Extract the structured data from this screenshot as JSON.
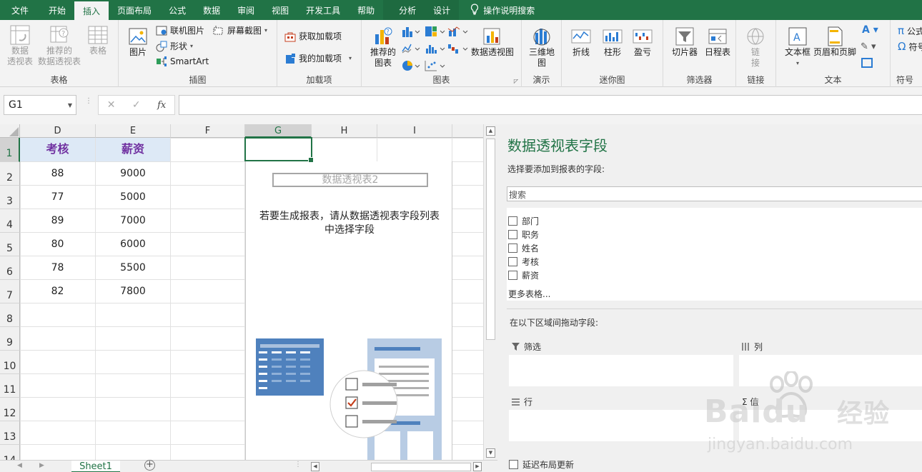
{
  "tabs": [
    "文件",
    "开始",
    "插入",
    "页面布局",
    "公式",
    "数据",
    "审阅",
    "视图",
    "开发工具",
    "帮助",
    "分析",
    "设计"
  ],
  "tab_search": "操作说明搜索",
  "ribbon": {
    "table_group": {
      "label": "表格",
      "pivot": "数据\n透视表",
      "rec_pivot": "推荐的\n数据透视表",
      "table": "表格"
    },
    "illus_group": {
      "label": "插图",
      "picture": "图片",
      "online_pic": "联机图片",
      "shapes": "形状",
      "smartart": "SmartArt",
      "screenshot": "屏幕截图"
    },
    "addin_group": {
      "label": "加载项",
      "get": "获取加载项",
      "my": "我的加载项"
    },
    "chart_group": {
      "label": "图表",
      "rec": "推荐的\n图表",
      "pivotchart": "数据透视图"
    },
    "tour_group": {
      "label": "演示",
      "map3d": "三维地\n图"
    },
    "spark_group": {
      "label": "迷你图",
      "line": "折线",
      "column": "柱形",
      "winloss": "盈亏"
    },
    "filter_group": {
      "label": "筛选器",
      "slicer": "切片器",
      "timeline": "日程表"
    },
    "link_group": {
      "label": "链接",
      "link": "链\n接"
    },
    "text_group": {
      "label": "文本",
      "textbox": "文本框",
      "header": "页眉和页脚"
    },
    "sym_group": {
      "label": "符号",
      "eq": "公式",
      "sym": "符号"
    }
  },
  "namebox": "G1",
  "fx": "fx",
  "columns": [
    "D",
    "E",
    "F",
    "G",
    "H",
    "I"
  ],
  "rows": [
    "1",
    "2",
    "3",
    "4",
    "5",
    "6",
    "7",
    "8",
    "9",
    "10",
    "11",
    "12",
    "13",
    "14"
  ],
  "table": {
    "headers": [
      "考核",
      "薪资"
    ],
    "rows": [
      [
        "88",
        "9000"
      ],
      [
        "77",
        "5000"
      ],
      [
        "89",
        "7000"
      ],
      [
        "80",
        "6000"
      ],
      [
        "78",
        "5500"
      ],
      [
        "82",
        "7800"
      ]
    ]
  },
  "pivot": {
    "title": "数据透视表2",
    "msg_line1": "若要生成报表，请从数据透视表字段列表",
    "msg_line2": "中选择字段"
  },
  "sheet": "Sheet1",
  "panel": {
    "title": "数据透视表字段",
    "subtitle": "选择要添加到报表的字段:",
    "search_placeholder": "搜索",
    "fields": [
      "部门",
      "职务",
      "姓名",
      "考核",
      "薪资"
    ],
    "more": "更多表格...",
    "drag_label": "在以下区域间拖动字段:",
    "areas": {
      "filter": "筛选",
      "columns": "列",
      "rows": "行",
      "values": "Σ 值"
    },
    "defer": "延迟布局更新"
  },
  "watermark": {
    "brand": "Baidu",
    "cn": "经验",
    "url": "jingyan.baidu.com"
  }
}
